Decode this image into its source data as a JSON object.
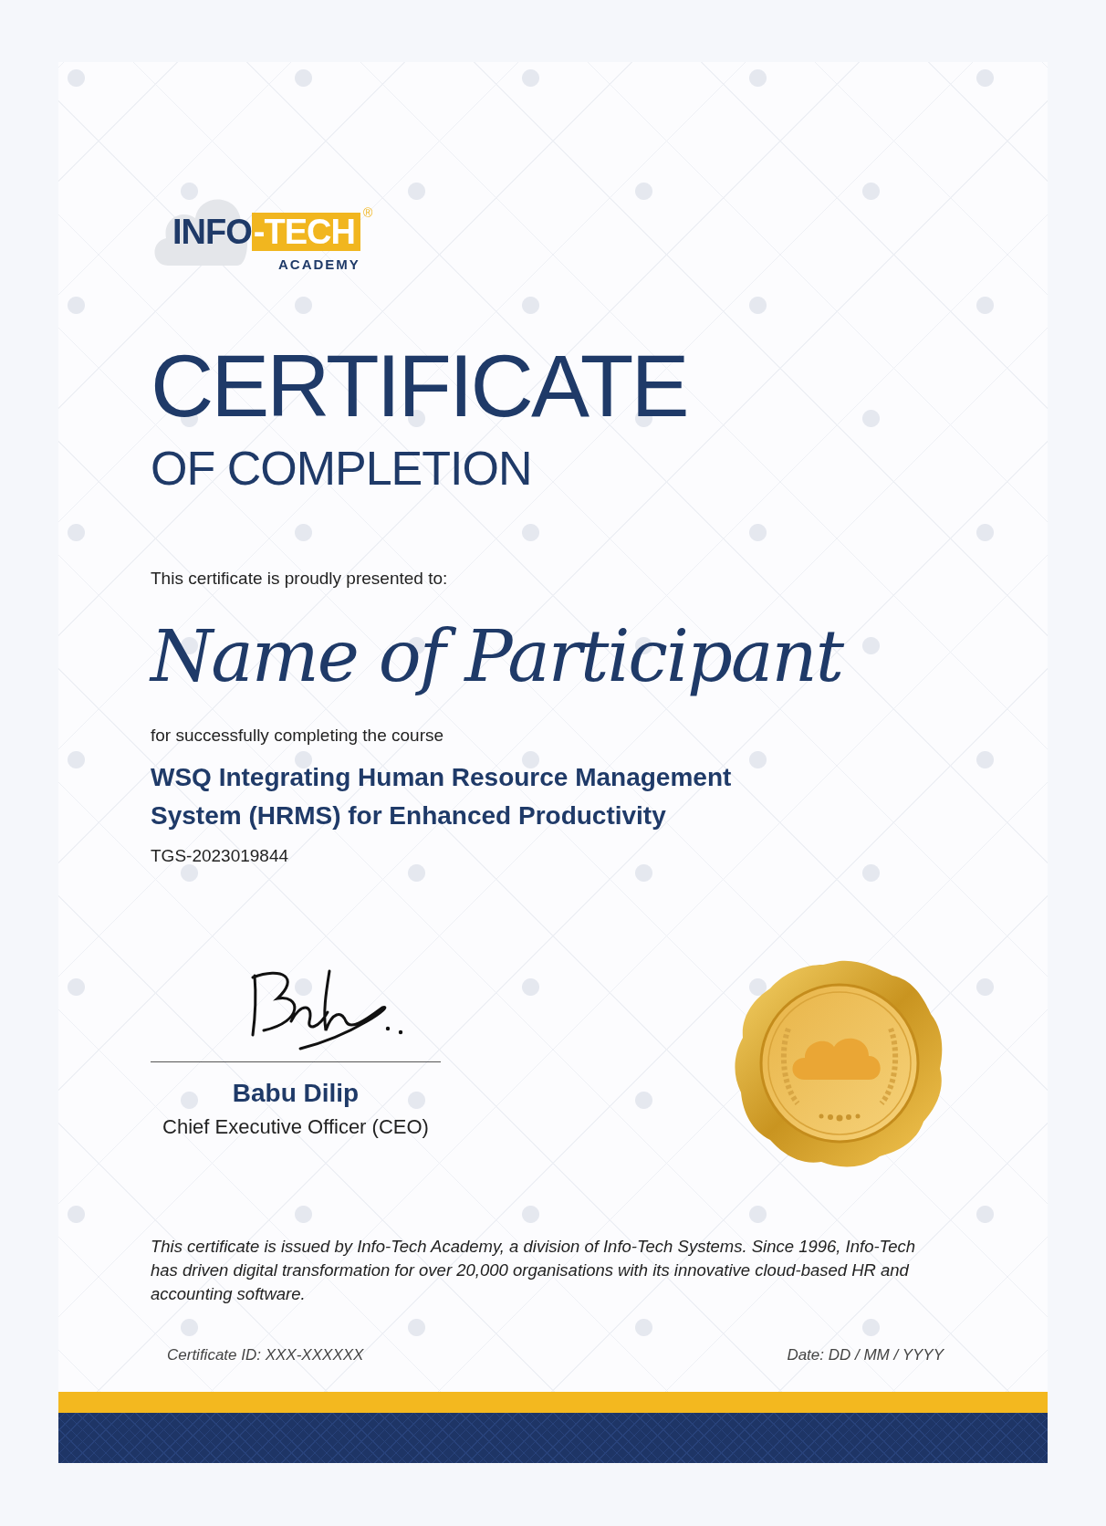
{
  "logo": {
    "brand_left": "INFO",
    "brand_right": "-TECH",
    "registered": "®",
    "subtitle": "ACADEMY"
  },
  "title": "CERTIFICATE",
  "subtitle": "OF COMPLETION",
  "presented_to": "This certificate is proudly presented to:",
  "participant": "Name of Participant",
  "course_intro": "for successfully completing the course",
  "course_title": "WSQ Integrating Human Resource Management System (HRMS) for Enhanced Productivity",
  "course_code": "TGS-2023019844",
  "signatory": {
    "name": "Babu Dilip",
    "role": "Chief Executive Officer (CEO)"
  },
  "statement": "This certificate is issued by Info-Tech Academy, a division of Info-Tech Systems. Since 1996, Info-Tech has driven digital transformation for over 20,000 organisations with its innovative cloud-based HR and accounting software.",
  "certificate_id": "Certificate ID: XXX-XXXXXX",
  "date": "Date: DD / MM / YYYY"
}
